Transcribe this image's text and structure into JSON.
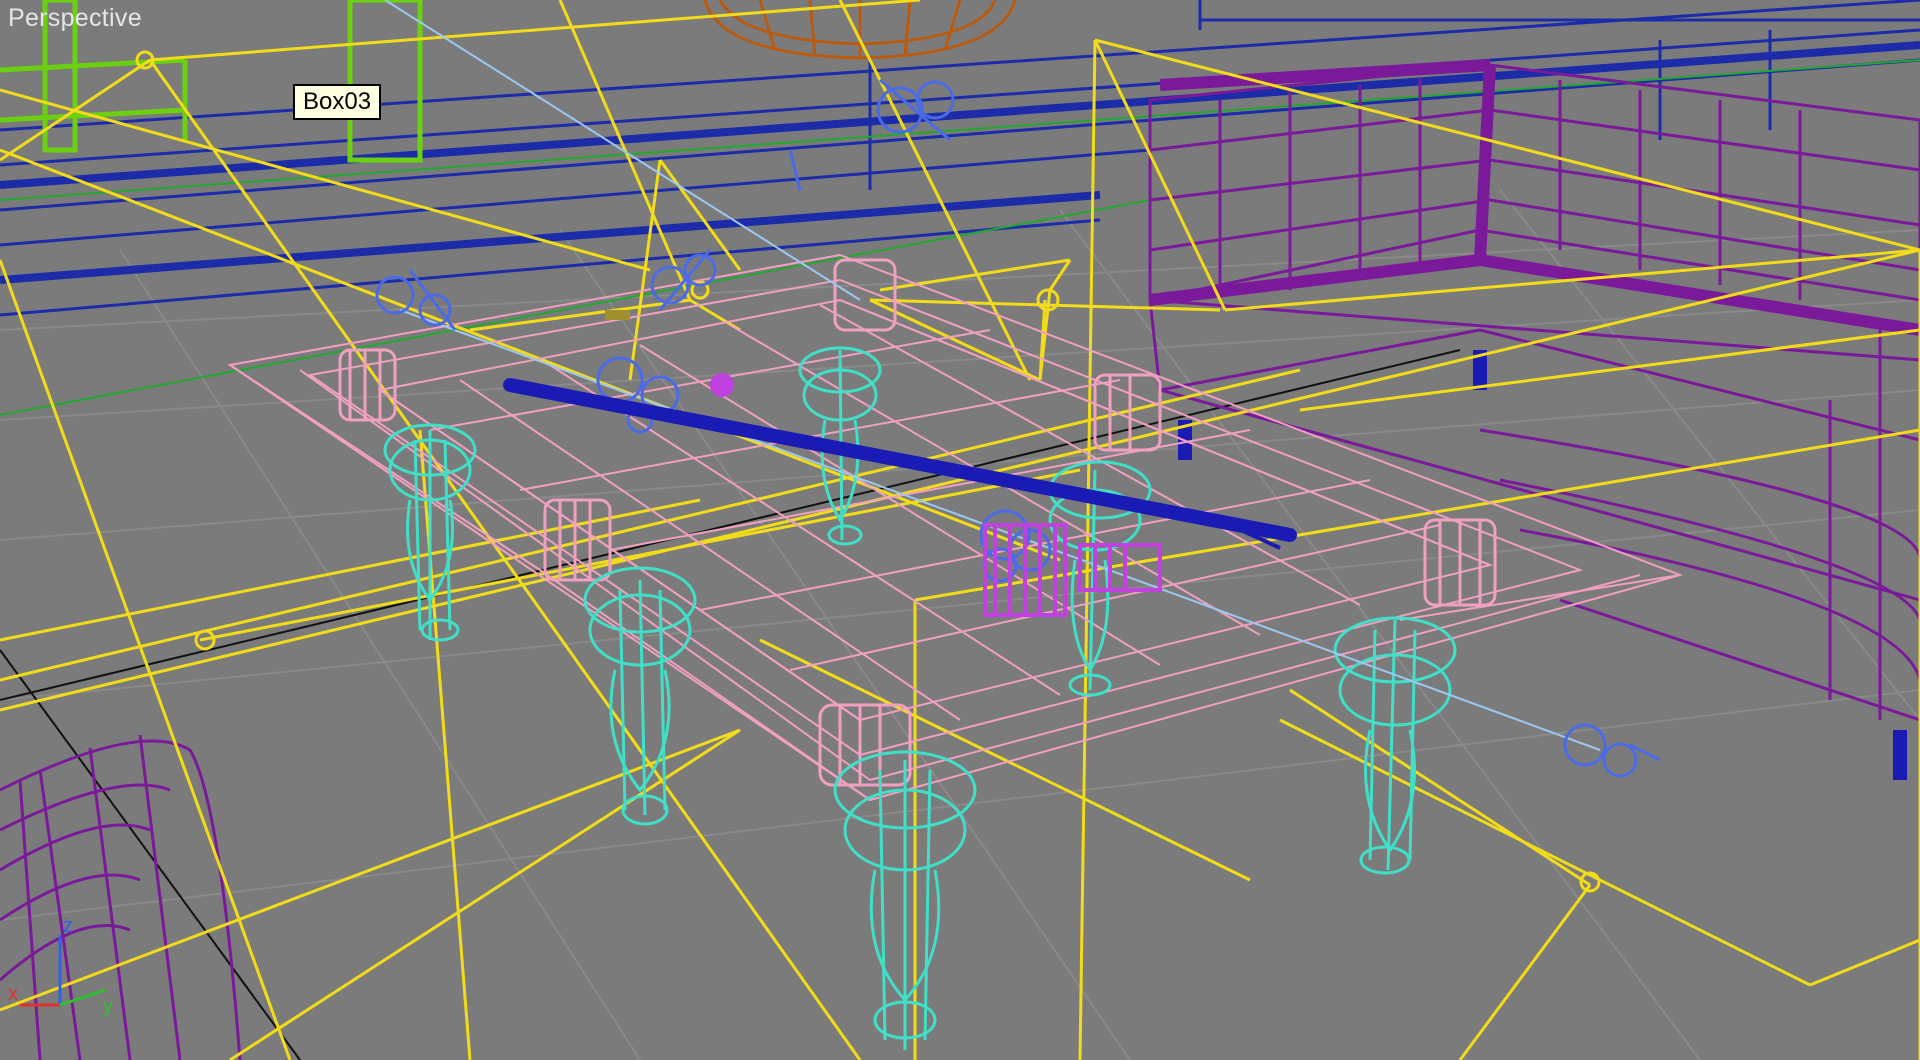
{
  "viewport": {
    "label": "Perspective"
  },
  "tooltip": {
    "object_name": "Box03"
  },
  "axis_gizmo": {
    "x_label": "x",
    "y_label": "y",
    "z_label": "z"
  },
  "colors": {
    "background": "#7b7b7b",
    "grid": "#8a8a8a",
    "grid_axis": "#111111",
    "gizmo_box": "#f2dc1a",
    "table": "#f0a0c0",
    "legs": "#40e0c8",
    "sofa": "#7a1a9a",
    "cue": "#1a1ab4",
    "lamp": "#b85a10",
    "wall_lines": "#1c2ca8",
    "green_lines": "#6ad010",
    "ball": "#c040e0",
    "light_icons": "#4a6ae8"
  },
  "icons": [
    "light-icon",
    "camera-icon",
    "axis-gizmo-icon"
  ]
}
